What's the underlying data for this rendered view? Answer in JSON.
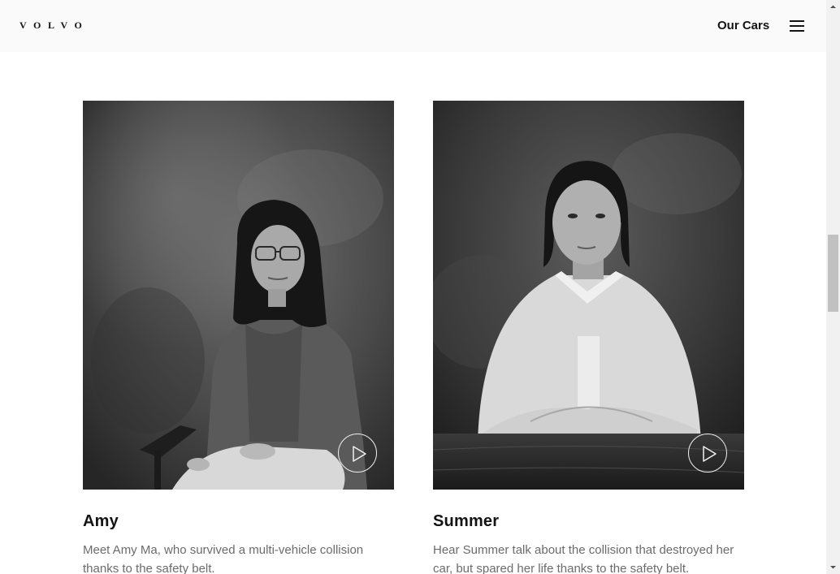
{
  "header": {
    "logo": "VOLVO",
    "nav_link": "Our Cars"
  },
  "cards": [
    {
      "name": "Amy",
      "description": "Meet Amy Ma, who survived a multi-vehicle collision thanks to the safety belt."
    },
    {
      "name": "Summer",
      "description": "Hear Summer talk about the collision that destroyed her car, but spared her life thanks to the safety belt."
    }
  ],
  "icons": {
    "menu": "hamburger-menu-icon",
    "play": "play-icon",
    "scroll_up": "arrow-up-icon",
    "scroll_down": "arrow-down-icon"
  }
}
